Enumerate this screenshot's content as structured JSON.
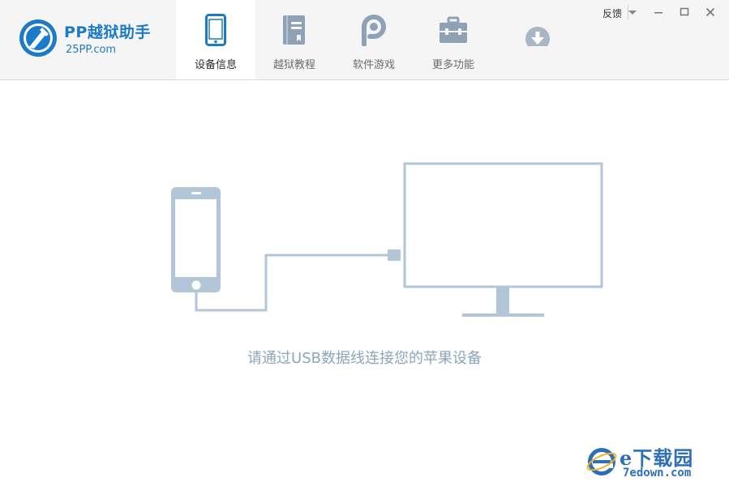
{
  "app": {
    "logo_title": "PP越狱助手",
    "logo_sub": "25PP.com",
    "brand_color": "#1b7bc8"
  },
  "tabs": [
    {
      "label": "设备信息",
      "icon": "phone-icon",
      "active": true
    },
    {
      "label": "越狱教程",
      "icon": "book-icon",
      "active": false
    },
    {
      "label": "软件游戏",
      "icon": "pp-icon",
      "active": false
    },
    {
      "label": "更多功能",
      "icon": "toolbox-icon",
      "active": false
    },
    {
      "label": "",
      "icon": "download-icon",
      "active": false
    }
  ],
  "window": {
    "feedback_label": "反馈",
    "controls": [
      "menu-dropdown-icon",
      "minimize-icon",
      "maximize-icon",
      "close-icon"
    ]
  },
  "main": {
    "hint": "请通过USB数据线连接您的苹果设备",
    "illustration_color": "#b3c6d7"
  },
  "watermark": {
    "text": "е下载园",
    "url": "7edown.com"
  }
}
